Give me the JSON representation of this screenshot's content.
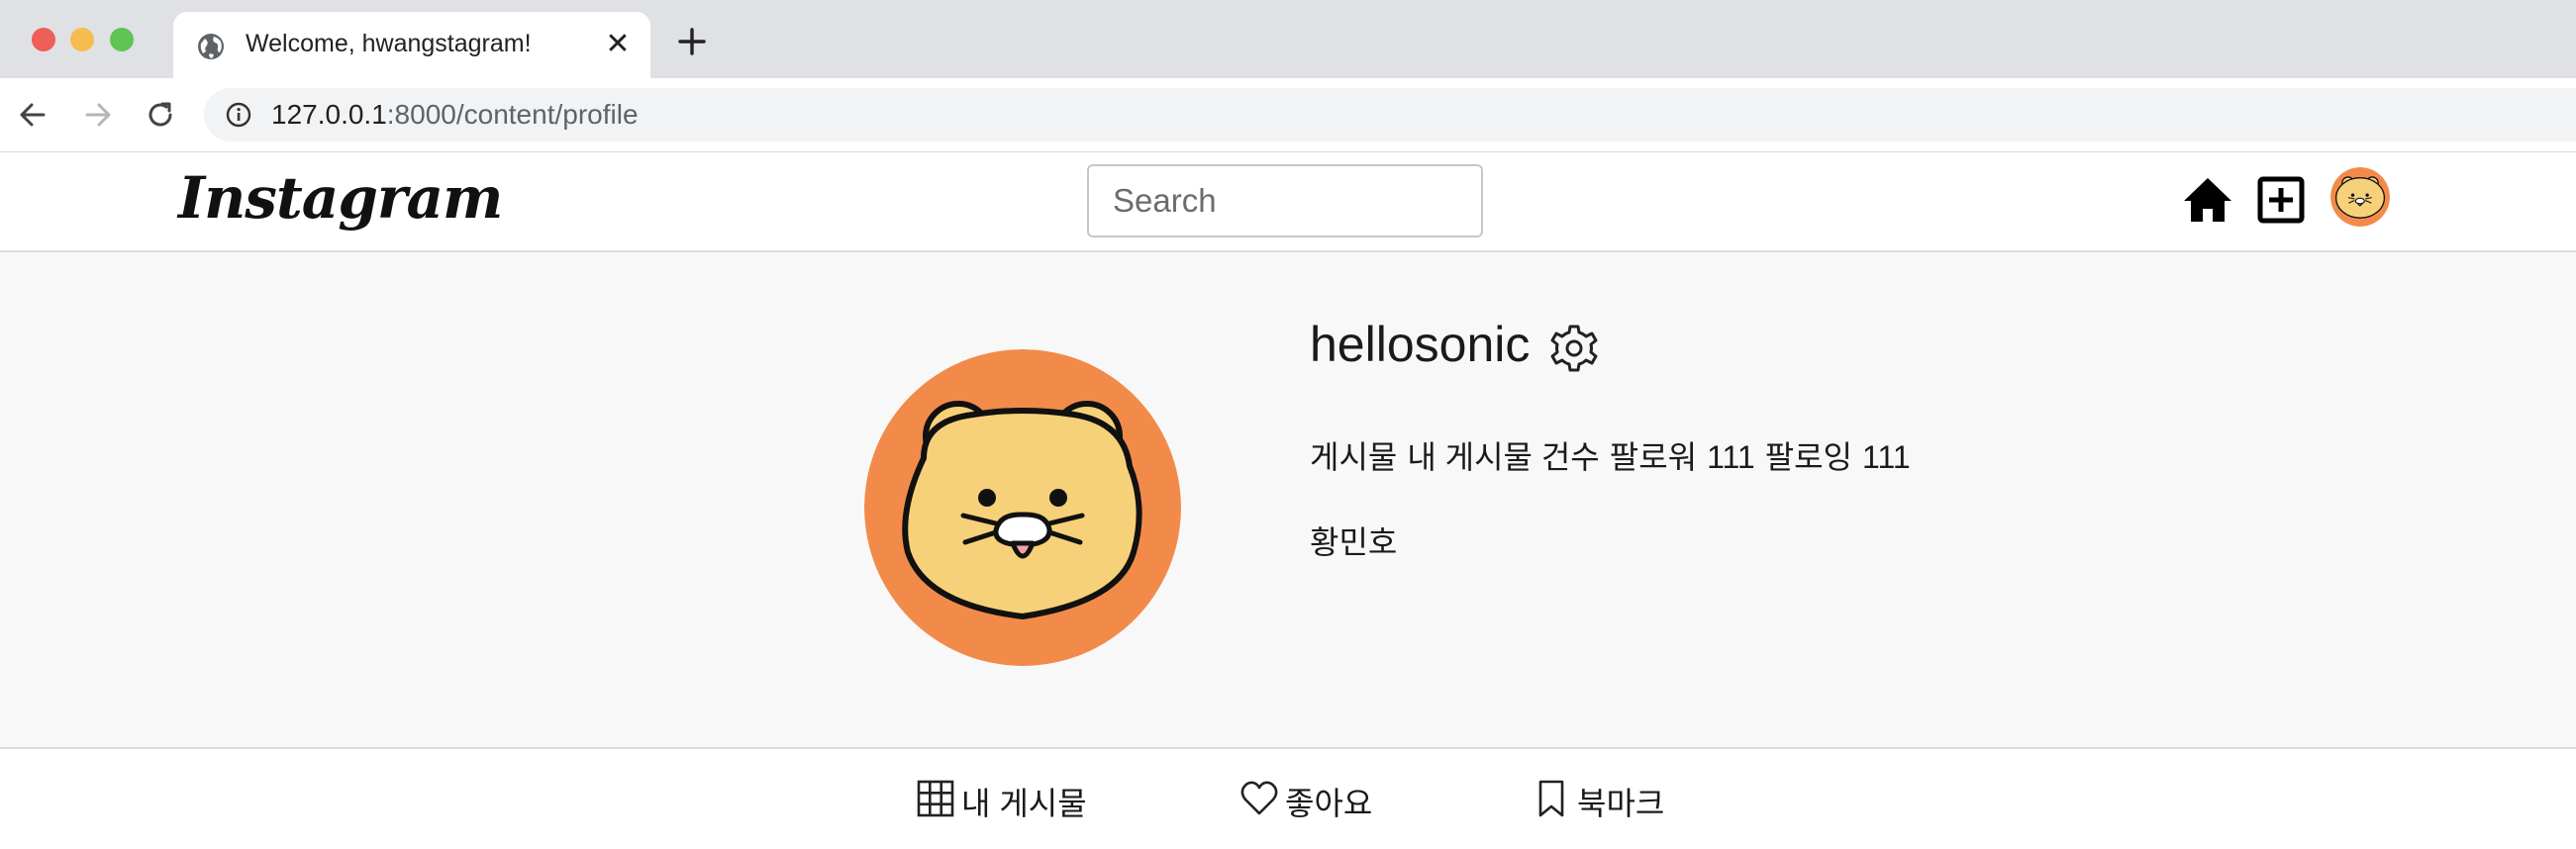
{
  "browser": {
    "tab_title": "Welcome, hwangstagram!",
    "tab_close": "✕",
    "url_host": "127.0.0.1",
    "url_rest": ":8000/content/profile"
  },
  "header": {
    "logo": "Instagram",
    "search_placeholder": "Search"
  },
  "profile": {
    "username": "hellosonic",
    "stats": {
      "posts_label": "게시물",
      "posts_value": "내 게시물 건수",
      "followers_label": "팔로워",
      "followers_value": "111",
      "following_label": "팔로잉",
      "following_value": "111"
    },
    "real_name": "황민호"
  },
  "profile_tabs": [
    {
      "label": "내 게시물",
      "icon": "grid-icon"
    },
    {
      "label": "좋아요",
      "icon": "heart-icon"
    },
    {
      "label": "북마크",
      "icon": "bookmark-icon"
    }
  ],
  "colors": {
    "avatar_bg": "#f28b4a",
    "bear_face": "#f7d179",
    "profile_bg": "#f8f8f8"
  }
}
